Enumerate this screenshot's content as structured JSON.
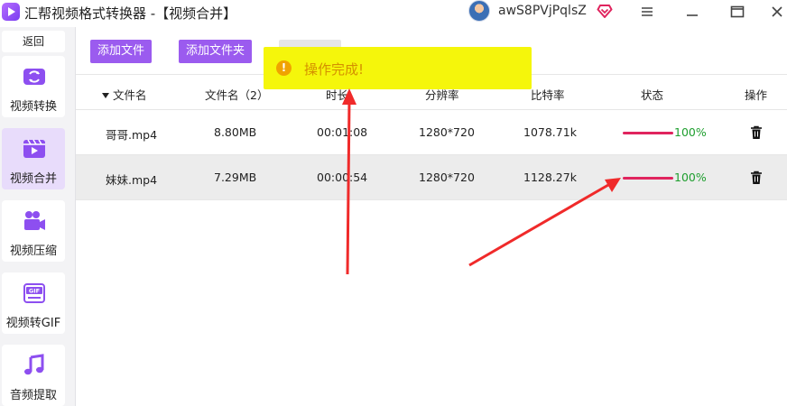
{
  "window": {
    "title": "汇帮视频格式转换器  -【视频合并】",
    "user_name": "awS8PVjPqlsZ"
  },
  "sidebar": {
    "back_label": "返回",
    "items": [
      {
        "label": "视频转换",
        "icon": "video-convert-icon",
        "active": false
      },
      {
        "label": "视频合并",
        "icon": "video-merge-icon",
        "active": true
      },
      {
        "label": "视频压缩",
        "icon": "video-compress-icon",
        "active": false
      },
      {
        "label": "视频转GIF",
        "icon": "gif-icon",
        "active": false
      },
      {
        "label": "音频提取",
        "icon": "music-note-icon",
        "active": false
      }
    ]
  },
  "toolbar": {
    "add_file_label": "添加文件",
    "add_folder_label": "添加文件夹"
  },
  "table": {
    "headers": {
      "name": "文件名",
      "size": "文件名（2）",
      "duration": "时长",
      "resolution": "分辨率",
      "bitrate": "比特率",
      "status": "状态",
      "action": "操作"
    },
    "rows": [
      {
        "name": "哥哥.mp4",
        "size": "8.80MB",
        "duration": "00:01:08",
        "resolution": "1280*720",
        "bitrate": "1078.71k",
        "progress": 1.0,
        "progress_label": "100%"
      },
      {
        "name": "妹妹.mp4",
        "size": "7.29MB",
        "duration": "00:00:54",
        "resolution": "1280*720",
        "bitrate": "1128.27k",
        "progress": 1.0,
        "progress_label": "100%"
      }
    ]
  },
  "toast": {
    "message": "操作完成!",
    "icon": "warning-icon"
  },
  "colors": {
    "accent": "#9b5bef",
    "active_nav": "#e8dcfb",
    "toast_bg": "#f5f60b",
    "progress": "#e0245e",
    "success_text": "#1e9e2e",
    "annotation": "#f02a2a"
  }
}
